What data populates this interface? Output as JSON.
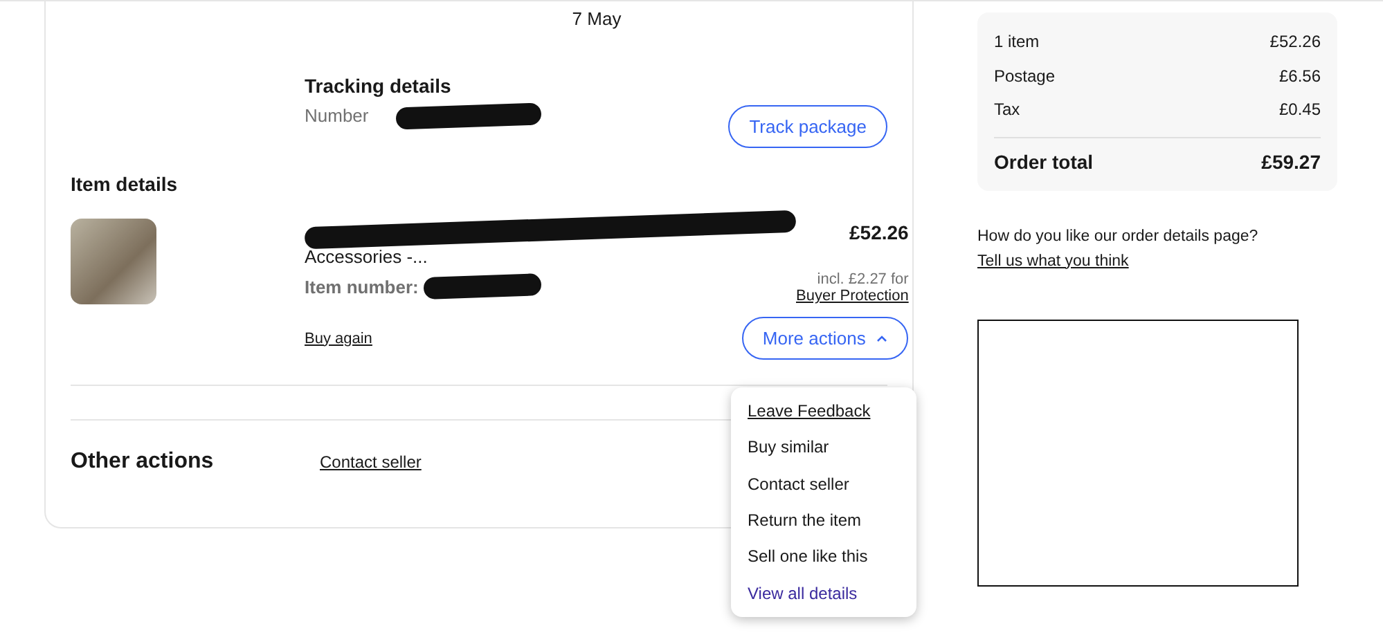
{
  "delivery": {
    "date": "7 May"
  },
  "tracking": {
    "title": "Tracking details",
    "number_label": "Number",
    "button": "Track package"
  },
  "item": {
    "section_title": "Item details",
    "title_visible": "Accessories -...",
    "item_number_label": "Item number:",
    "price": "£52.26",
    "protection_note": "incl. £2.27 for",
    "protection_link": "Buyer Protection",
    "buy_again": "Buy again",
    "more_actions": "More actions",
    "more_actions_expanded": true
  },
  "menu": [
    {
      "label": "Leave Feedback",
      "kind": "underlined"
    },
    {
      "label": "Buy similar",
      "kind": "plain"
    },
    {
      "label": "Contact seller",
      "kind": "plain"
    },
    {
      "label": "Return the item",
      "kind": "plain"
    },
    {
      "label": "Sell one like this",
      "kind": "plain"
    },
    {
      "label": "View all details",
      "kind": "accent"
    }
  ],
  "other_actions": {
    "title": "Other actions",
    "link": "Contact seller"
  },
  "summary": {
    "rows": [
      {
        "label": "1 item",
        "value": "£52.26"
      },
      {
        "label": "Postage",
        "value": "£6.56"
      },
      {
        "label": "Tax",
        "value": "£0.45"
      }
    ],
    "total_label": "Order total",
    "total_value": "£59.27"
  },
  "feedback": {
    "question": "How do you like our order details page?",
    "link": "Tell us what you think"
  }
}
